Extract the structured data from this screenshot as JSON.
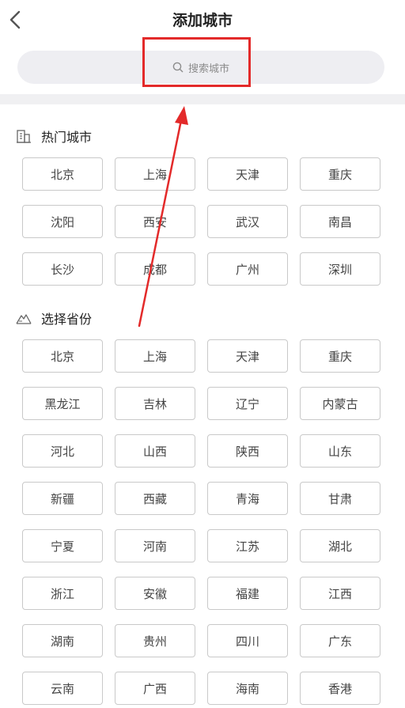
{
  "header": {
    "title": "添加城市",
    "back_icon": "chevron-left-icon"
  },
  "search": {
    "placeholder": "搜索城市",
    "icon": "search-icon"
  },
  "hot_cities": {
    "label": "热门城市",
    "icon": "building-icon",
    "items": [
      "北京",
      "上海",
      "天津",
      "重庆",
      "沈阳",
      "西安",
      "武汉",
      "南昌",
      "长沙",
      "成都",
      "广州",
      "深圳"
    ]
  },
  "provinces": {
    "label": "选择省份",
    "icon": "mountain-icon",
    "items": [
      "北京",
      "上海",
      "天津",
      "重庆",
      "黑龙江",
      "吉林",
      "辽宁",
      "内蒙古",
      "河北",
      "山西",
      "陕西",
      "山东",
      "新疆",
      "西藏",
      "青海",
      "甘肃",
      "宁夏",
      "河南",
      "江苏",
      "湖北",
      "浙江",
      "安徽",
      "福建",
      "江西",
      "湖南",
      "贵州",
      "四川",
      "广东",
      "云南",
      "广西",
      "海南",
      "香港"
    ]
  },
  "annotation": {
    "highlight_color": "#e32a2a"
  }
}
